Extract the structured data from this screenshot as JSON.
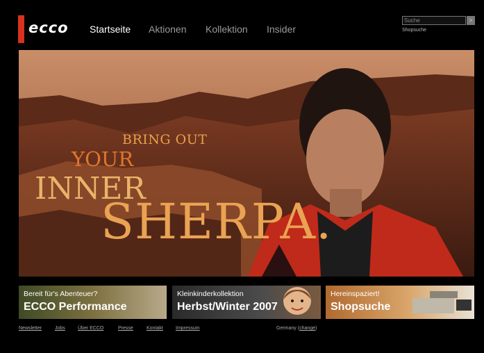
{
  "header": {
    "logo": "ecco",
    "nav": [
      {
        "label": "Startseite"
      },
      {
        "label": "Aktionen"
      },
      {
        "label": "Kollektion"
      },
      {
        "label": "Insider"
      }
    ],
    "search_placeholder": "Suche",
    "search_button": ">",
    "shopsuche_link": "Shopsuche"
  },
  "hero": {
    "line1": "BRING OUT",
    "line2": "YOUR",
    "line3": "INNER",
    "line4": "SHERPA."
  },
  "banners": [
    {
      "small": "Bereit für's Abenteuer?",
      "big": "ECCO Performance"
    },
    {
      "small": "Kleinkinderkollektion",
      "big": "Herbst/Winter 2007"
    },
    {
      "small": "Hereinspaziert!",
      "big": "Shopsuche"
    }
  ],
  "footer": {
    "links": [
      {
        "label": "Newsletter"
      },
      {
        "label": "Jobs"
      },
      {
        "label": "Über ECCO"
      },
      {
        "label": "Presse"
      },
      {
        "label": "Kontakt"
      },
      {
        "label": "Impressum"
      }
    ],
    "country": "Germany",
    "change": "change"
  },
  "colors": {
    "accent": "#d8321e",
    "hero_text": "#e8a04a"
  }
}
